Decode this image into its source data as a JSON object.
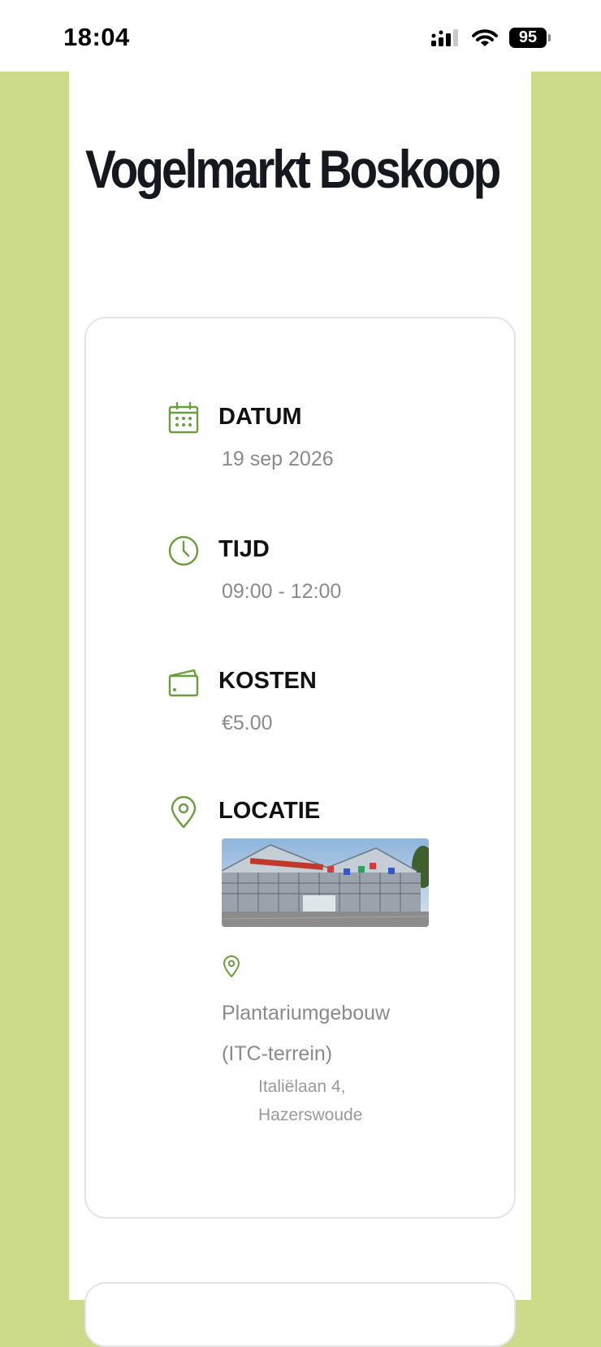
{
  "status_bar": {
    "time": "18:04",
    "battery": "95"
  },
  "page": {
    "title": "Vogelmarkt Boskoop"
  },
  "info": {
    "date": {
      "label": "DATUM",
      "value": "19 sep 2026",
      "icon": "calendar-icon"
    },
    "time": {
      "label": "TIJD",
      "value": "09:00 - 12:00",
      "icon": "clock-icon"
    },
    "cost": {
      "label": "KOSTEN",
      "value": "€5.00",
      "icon": "wallet-icon"
    },
    "location": {
      "label": "LOCATIE",
      "icon": "map-pin-icon",
      "venue_name": "Plantariumgebouw (ITC-terrein)",
      "address": "Italiëlaan 4, Hazerswoude"
    }
  },
  "colors": {
    "accent": "#6a9e3c",
    "side_background": "#ccdb8a",
    "title": "#15181e",
    "muted_text": "#8a8a8a"
  }
}
